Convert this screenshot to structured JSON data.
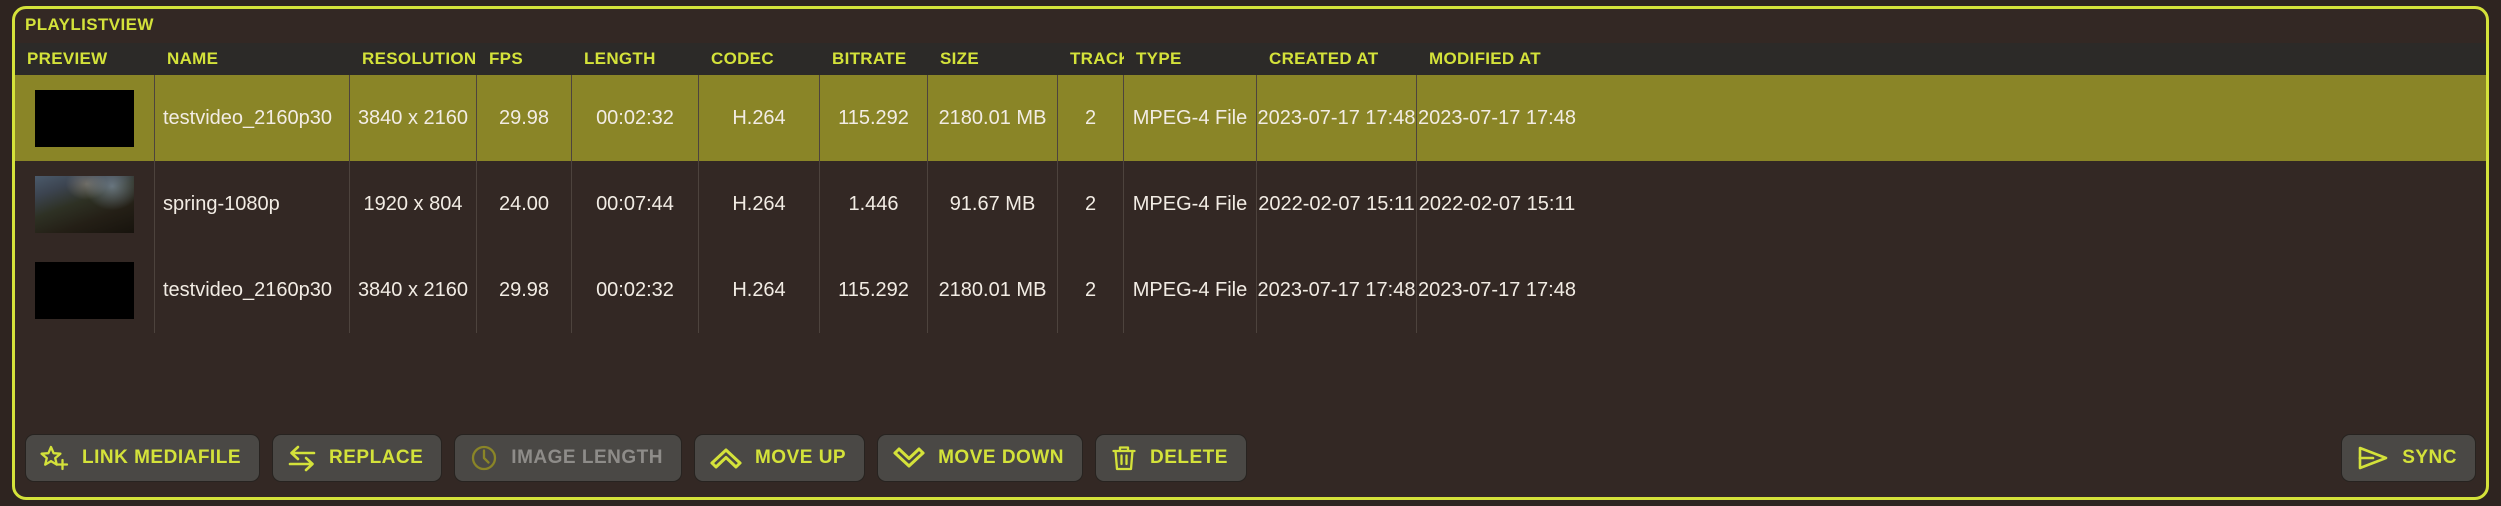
{
  "panel": {
    "title": "PLAYLISTVIEW",
    "accent_color": "#d4e23a",
    "background_color": "#332824",
    "selected_row_color": "#8a8527",
    "header_background_color": "#2c2a28",
    "button_background_color": "#4a4845"
  },
  "table": {
    "columns": [
      {
        "key": "preview",
        "label": "PREVIEW"
      },
      {
        "key": "name",
        "label": "NAME"
      },
      {
        "key": "resolution",
        "label": "RESOLUTION"
      },
      {
        "key": "fps",
        "label": "FPS"
      },
      {
        "key": "length",
        "label": "LENGTH"
      },
      {
        "key": "codec",
        "label": "CODEC"
      },
      {
        "key": "bitrate",
        "label": "BITRATE"
      },
      {
        "key": "size",
        "label": "SIZE"
      },
      {
        "key": "tracks",
        "label": "TRACKS"
      },
      {
        "key": "type",
        "label": "TYPE"
      },
      {
        "key": "created",
        "label": "CREATED AT"
      },
      {
        "key": "modified",
        "label": "MODIFIED AT"
      }
    ],
    "rows": [
      {
        "selected": true,
        "thumbnail": "black",
        "name": "testvideo_2160p30",
        "resolution": "3840 x 2160",
        "fps": "29.98",
        "length": "00:02:32",
        "codec": "H.264",
        "bitrate": "115.292",
        "size": "2180.01 MB",
        "tracks": "2",
        "type": "MPEG-4 File",
        "created": "2023-07-17 17:48",
        "modified": "2023-07-17 17:48"
      },
      {
        "selected": false,
        "thumbnail": "landscape",
        "name": "spring-1080p",
        "resolution": "1920 x 804",
        "fps": "24.00",
        "length": "00:07:44",
        "codec": "H.264",
        "bitrate": "1.446",
        "size": "91.67 MB",
        "tracks": "2",
        "type": "MPEG-4 File",
        "created": "2022-02-07 15:11",
        "modified": "2022-02-07 15:11"
      },
      {
        "selected": false,
        "thumbnail": "black",
        "name": "testvideo_2160p30",
        "resolution": "3840 x 2160",
        "fps": "29.98",
        "length": "00:02:32",
        "codec": "H.264",
        "bitrate": "115.292",
        "size": "2180.01 MB",
        "tracks": "2",
        "type": "MPEG-4 File",
        "created": "2023-07-17 17:48",
        "modified": "2023-07-17 17:48"
      }
    ]
  },
  "toolbar": {
    "buttons": [
      {
        "id": "link-mediafile",
        "label": "LINK MEDIAFILE",
        "icon": "star-plus-icon",
        "disabled": false
      },
      {
        "id": "replace",
        "label": "REPLACE",
        "icon": "swap-arrows-icon",
        "disabled": false
      },
      {
        "id": "image-length",
        "label": "IMAGE LENGTH",
        "icon": "clock-icon",
        "disabled": true
      },
      {
        "id": "move-up",
        "label": "MOVE UP",
        "icon": "chevron-up-icon",
        "disabled": false
      },
      {
        "id": "move-down",
        "label": "MOVE DOWN",
        "icon": "chevron-down-icon",
        "disabled": false
      },
      {
        "id": "delete",
        "label": "DELETE",
        "icon": "trash-icon",
        "disabled": false
      }
    ],
    "sync": {
      "id": "sync",
      "label": "SYNC",
      "icon": "send-arrow-icon",
      "disabled": false
    }
  }
}
